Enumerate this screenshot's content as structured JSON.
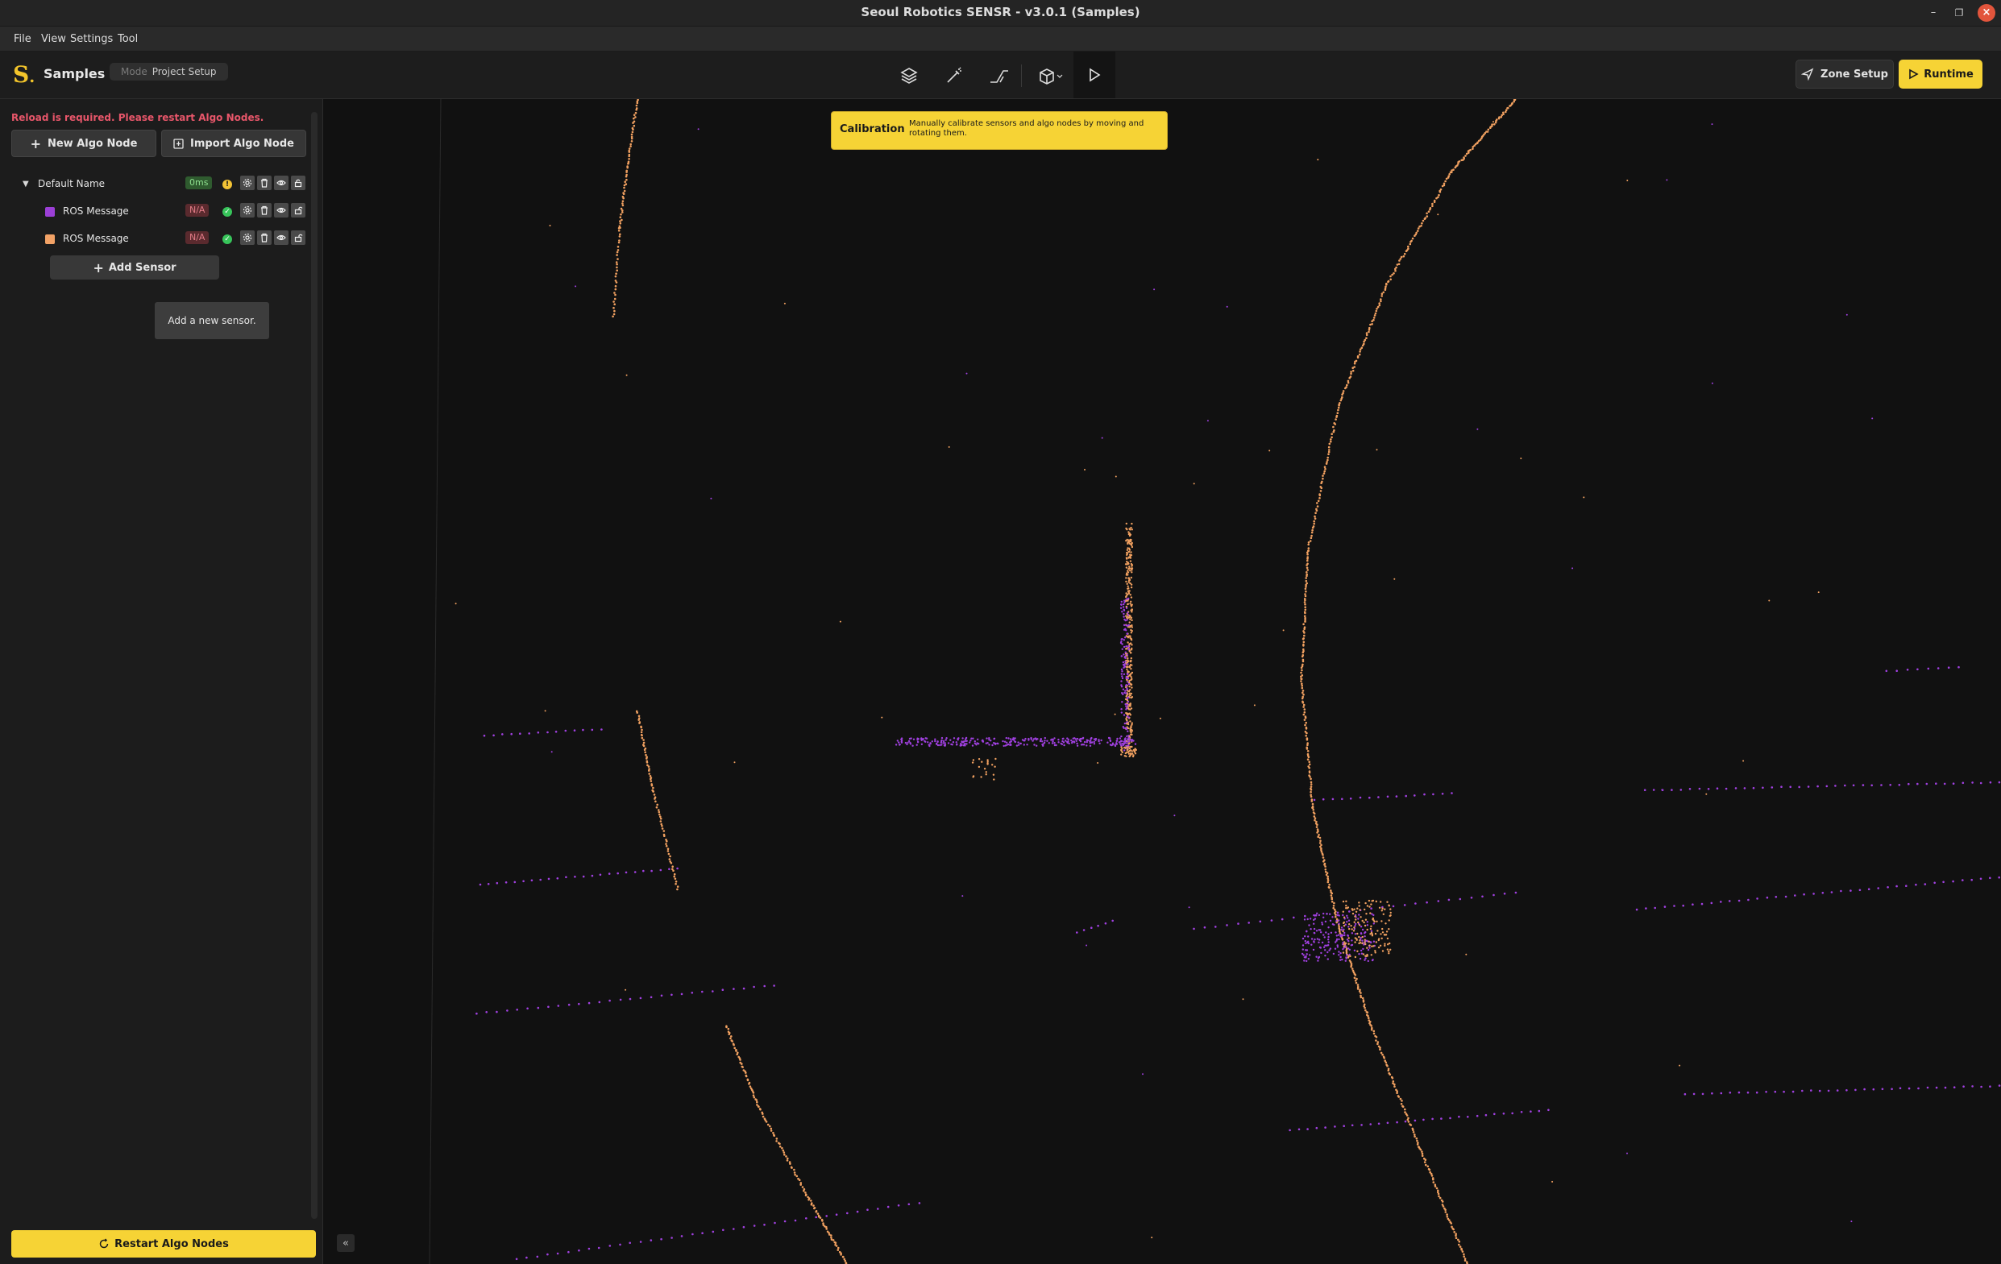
{
  "window": {
    "title": "Seoul Robotics SENSR - v3.0.1 (Samples)",
    "minimize_glyph": "–",
    "maximize_glyph": "❐",
    "close_glyph": "×"
  },
  "menu": [
    "File",
    "View",
    "Settings",
    "Tool"
  ],
  "toolbar": {
    "logo": "S",
    "project_name": "Samples",
    "mode_label": "Mode",
    "mode_value": "Project Setup",
    "tools": [
      "layers-icon",
      "magic-wand-icon",
      "ramp-icon",
      "cube-view-icon",
      "play-icon"
    ],
    "zone_setup_label": "Zone Setup",
    "runtime_label": "Runtime"
  },
  "sidebar": {
    "warning": "Reload is required. Please restart Algo Nodes.",
    "new_algo_node": "New Algo Node",
    "import_algo_node": "Import Algo Node",
    "tree": {
      "node": {
        "name": "Default Name",
        "latency": "0ms",
        "status": "!"
      },
      "sensors": [
        {
          "name": "ROS Message",
          "color": "#9b3fd6",
          "latency": "N/A",
          "status": "✓"
        },
        {
          "name": "ROS Message",
          "color": "#f2a266",
          "latency": "N/A",
          "status": "✓"
        }
      ]
    },
    "add_sensor": "Add Sensor",
    "tooltip": "Add a new sensor.",
    "restart_label": "Restart Algo Nodes",
    "collapse_glyph": "«"
  },
  "calibration": {
    "title": "Calibration",
    "description": "Manually calibrate sensors and algo nodes by moving and rotating them."
  },
  "colors": {
    "accent": "#f6d335",
    "point_orange": "#f0a060",
    "point_purple": "#a040e0",
    "warning": "#e8566a"
  }
}
